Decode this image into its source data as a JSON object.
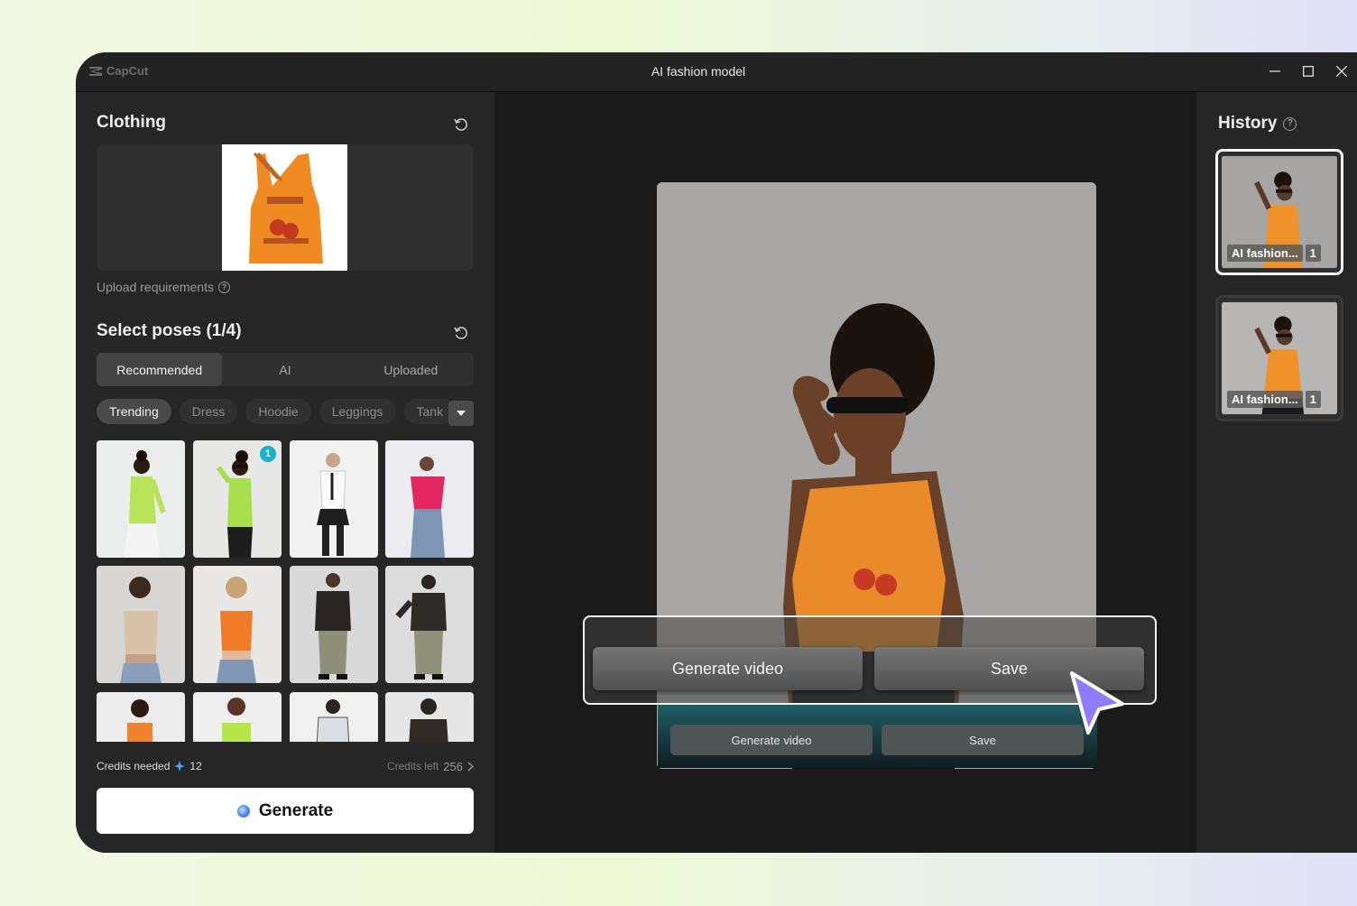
{
  "window": {
    "logo_text": "CapCut",
    "title": "AI fashion model"
  },
  "clothing": {
    "title": "Clothing",
    "upload_requirements": "Upload requirements"
  },
  "poses": {
    "title": "Select poses (1/4)",
    "tabs": [
      {
        "label": "Recommended",
        "active": true
      },
      {
        "label": "AI",
        "active": false
      },
      {
        "label": "Uploaded",
        "active": false
      }
    ],
    "chips": [
      {
        "label": "Trending",
        "active": true
      },
      {
        "label": "Dress",
        "active": false
      },
      {
        "label": "Hoodie",
        "active": false
      },
      {
        "label": "Leggings",
        "active": false
      },
      {
        "label": "Tank",
        "active": false
      }
    ],
    "selected_badge": "1"
  },
  "credits": {
    "needed_label": "Credits needed",
    "needed_value": "12",
    "left_label": "Credits left",
    "left_value": "256"
  },
  "generate_label": "Generate",
  "history": {
    "title": "History",
    "items": [
      {
        "label": "AI fashion...",
        "count": "1"
      },
      {
        "label": "AI fashion...",
        "count": "1"
      }
    ]
  },
  "preview": {
    "generate_video_label": "Generate video",
    "save_label": "Save"
  },
  "colors": {
    "accent_badge": "#18b2c9",
    "cursor": "#8e7bff",
    "tank": "#f08a22"
  }
}
